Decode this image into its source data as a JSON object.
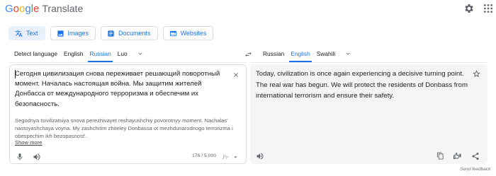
{
  "header": {
    "logo_google": [
      "G",
      "o",
      "o",
      "g",
      "l",
      "e"
    ],
    "product": "Translate"
  },
  "modes": [
    {
      "label": "Text",
      "icon": "translate-icon",
      "active": true
    },
    {
      "label": "Images",
      "icon": "image-icon",
      "active": false
    },
    {
      "label": "Documents",
      "icon": "document-icon",
      "active": false
    },
    {
      "label": "Websites",
      "icon": "website-icon",
      "active": false
    }
  ],
  "source_langs": [
    "Detect language",
    "English",
    "Russian",
    "Luo"
  ],
  "source_selected": "Russian",
  "target_langs": [
    "Russian",
    "English",
    "Swahili"
  ],
  "target_selected": "English",
  "source": {
    "text": "Сегодня цивилизация снова переживает решающий поворотный момент. Началась настоящая война. Мы защитим жителей Донбасса от международного терроризма и обеспечим их безопасность.",
    "transliteration": "Segodnya tsivilizatsiya snova perezhivayet reshayushchiy povorotnyy moment. Nachalas' nastoyashchaya voyna. My zashchitim zhiteley Donbassa ot mezhdunarodnogo terrorizma i obespechim ikh bezopasnost'.",
    "show_more": "Show more",
    "char_count": "176 / 5,000"
  },
  "target": {
    "text": "Today, civilization is once again experiencing a decisive turning point. The real war has begun. We will protect the residents of Donbass from international terrorism and ensure their safety."
  },
  "footer": {
    "feedback": "Send feedback"
  },
  "colors": {
    "accent": "#1a73e8",
    "active_bg": "#e8f0fe",
    "target_bg": "#f5f5f5"
  }
}
